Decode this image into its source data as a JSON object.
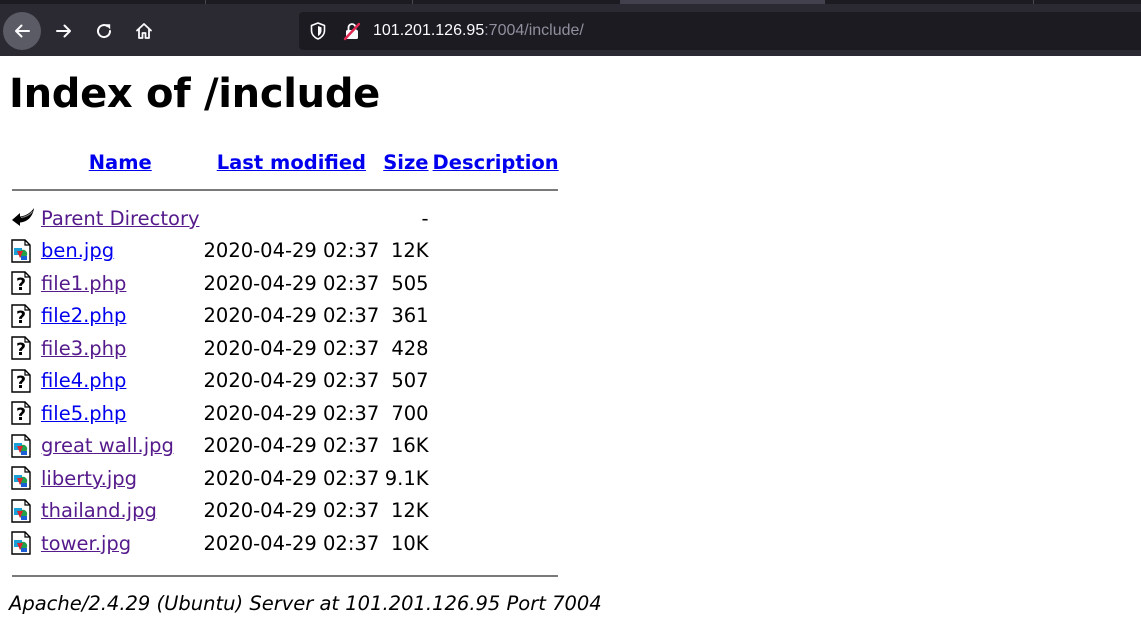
{
  "browser": {
    "url_host": "101.201.126.95",
    "url_rest": ":7004/include/"
  },
  "page": {
    "heading": "Index of /include",
    "columns": {
      "name": "Name",
      "last_modified": "Last modified",
      "size": "Size",
      "description": "Description"
    },
    "parent": {
      "name": "Parent Directory",
      "size": "-",
      "icon": "back-arrow-icon"
    },
    "rows": [
      {
        "name": "ben.jpg",
        "modified": "2020-04-29 02:37",
        "size": "12K",
        "icon": "image-file-icon",
        "visited": false
      },
      {
        "name": "file1.php",
        "modified": "2020-04-29 02:37",
        "size": "505",
        "icon": "unknown-file-icon",
        "visited": true
      },
      {
        "name": "file2.php",
        "modified": "2020-04-29 02:37",
        "size": "361",
        "icon": "unknown-file-icon",
        "visited": false
      },
      {
        "name": "file3.php",
        "modified": "2020-04-29 02:37",
        "size": "428",
        "icon": "unknown-file-icon",
        "visited": true
      },
      {
        "name": "file4.php",
        "modified": "2020-04-29 02:37",
        "size": "507",
        "icon": "unknown-file-icon",
        "visited": false
      },
      {
        "name": "file5.php",
        "modified": "2020-04-29 02:37",
        "size": "700",
        "icon": "unknown-file-icon",
        "visited": false
      },
      {
        "name": "great wall.jpg",
        "modified": "2020-04-29 02:37",
        "size": "16K",
        "icon": "image-file-icon",
        "visited": true
      },
      {
        "name": "liberty.jpg",
        "modified": "2020-04-29 02:37",
        "size": "9.1K",
        "icon": "image-file-icon",
        "visited": true
      },
      {
        "name": "thailand.jpg",
        "modified": "2020-04-29 02:37",
        "size": "12K",
        "icon": "image-file-icon",
        "visited": true
      },
      {
        "name": "tower.jpg",
        "modified": "2020-04-29 02:37",
        "size": "10K",
        "icon": "image-file-icon",
        "visited": true
      }
    ],
    "footer": "Apache/2.4.29 (Ubuntu) Server at 101.201.126.95 Port 7004"
  },
  "colors": {
    "chrome_bg": "#2b2a33",
    "urlbar_bg": "#1c1b22",
    "link": "#0000ee",
    "link_visited": "#551a8b"
  }
}
